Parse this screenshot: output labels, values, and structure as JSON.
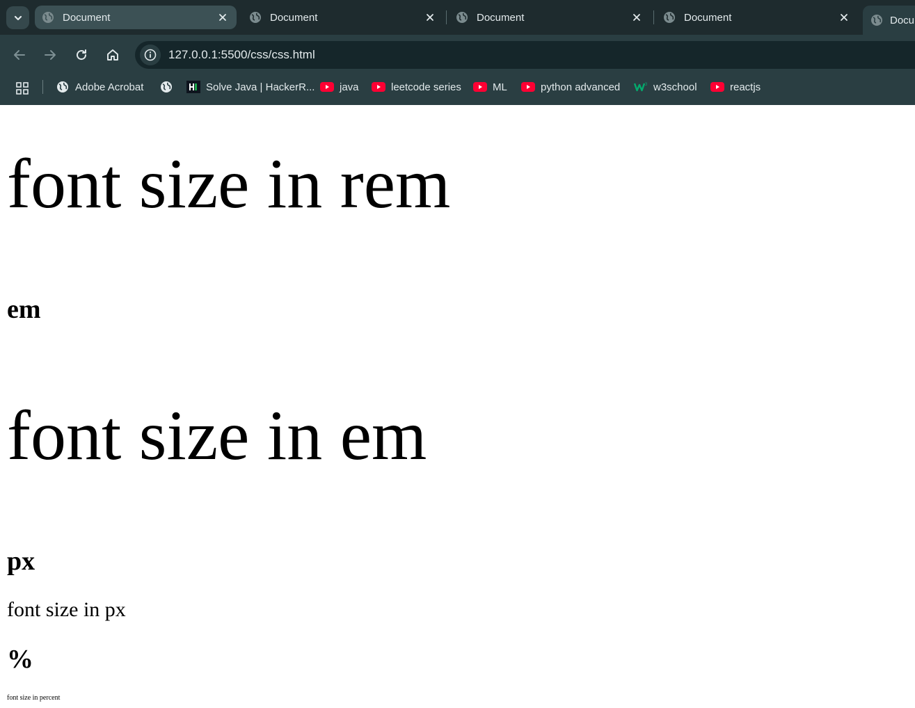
{
  "browser": {
    "tabs": [
      {
        "title": "Document",
        "active": true
      },
      {
        "title": "Document",
        "active": false
      },
      {
        "title": "Document",
        "active": false
      },
      {
        "title": "Document",
        "active": false
      },
      {
        "title": "Docu",
        "active": false
      }
    ],
    "address_bar": {
      "url": "127.0.0.1:5500/css/css.html"
    },
    "bookmarks": [
      {
        "label": "Adobe Acrobat",
        "icon": "globe-icon"
      },
      {
        "label": "",
        "icon": "globe-icon"
      },
      {
        "label": "Solve Java | HackerR...",
        "icon": "hackerrank-icon"
      },
      {
        "label": "java",
        "icon": "youtube-icon"
      },
      {
        "label": "leetcode series",
        "icon": "youtube-icon"
      },
      {
        "label": "ML",
        "icon": "youtube-icon"
      },
      {
        "label": "python advanced",
        "icon": "youtube-icon"
      },
      {
        "label": "w3school",
        "icon": "w3schools-icon"
      },
      {
        "label": "reactjs",
        "icon": "youtube-icon"
      }
    ],
    "colors": {
      "tabstrip_bg": "#1e2b2e",
      "toolbar_bg": "#2a3e42",
      "active_tab_bg": "#3c5155",
      "omnibox_bg": "#15262a",
      "youtube_red": "#ff0033",
      "w3schools_green": "#04aa6d",
      "text": "#e3eaec"
    }
  },
  "page": {
    "rem_text": "font size in rem",
    "em_heading": "em",
    "em_text": "font size in em",
    "px_heading": "px",
    "px_text": "font size in px",
    "percent_heading": "%",
    "percent_text": "font size in percent"
  }
}
